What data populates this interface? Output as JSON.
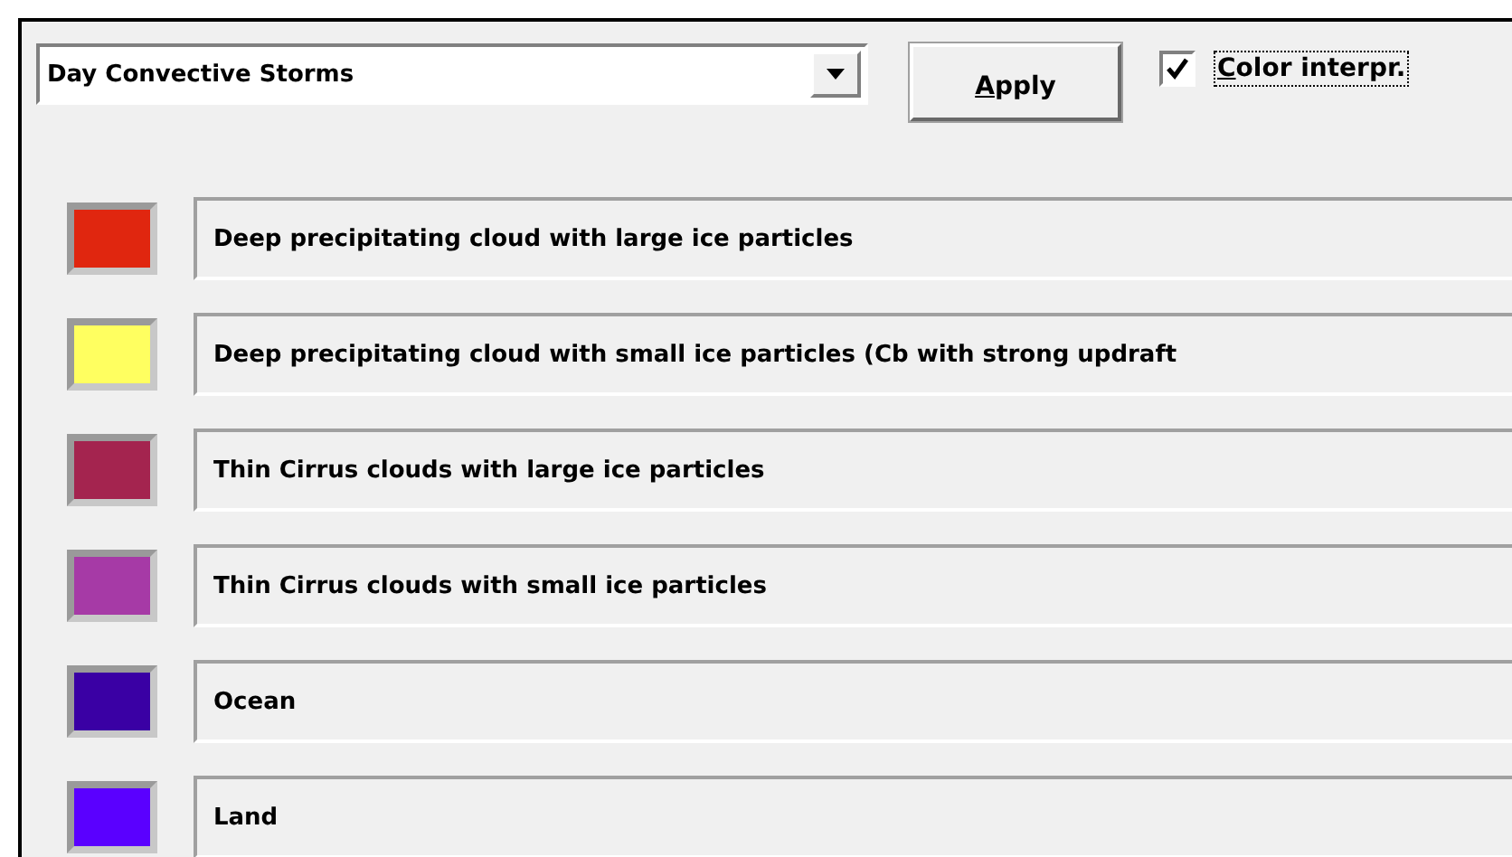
{
  "scheme_select": {
    "value": "Day Convective Storms"
  },
  "apply_button": {
    "mnemonic": "A",
    "rest": "pply"
  },
  "color_interp": {
    "label_mnemonic": "C",
    "label_rest": "olor interpr.",
    "checked": true
  },
  "classes": [
    {
      "label": "Deep precipitating cloud with large ice particles",
      "color": "#e0260f"
    },
    {
      "label": "Deep precipitating cloud with small ice particles (Cb with strong updraft",
      "color": "#ffff60"
    },
    {
      "label": "Thin Cirrus clouds with large ice particles",
      "color": "#a4244f"
    },
    {
      "label": "Thin Cirrus clouds with small ice particles",
      "color": "#a63aa6"
    },
    {
      "label": "Ocean",
      "color": "#3a00a4"
    },
    {
      "label": "Land",
      "color": "#5a00ff"
    }
  ]
}
